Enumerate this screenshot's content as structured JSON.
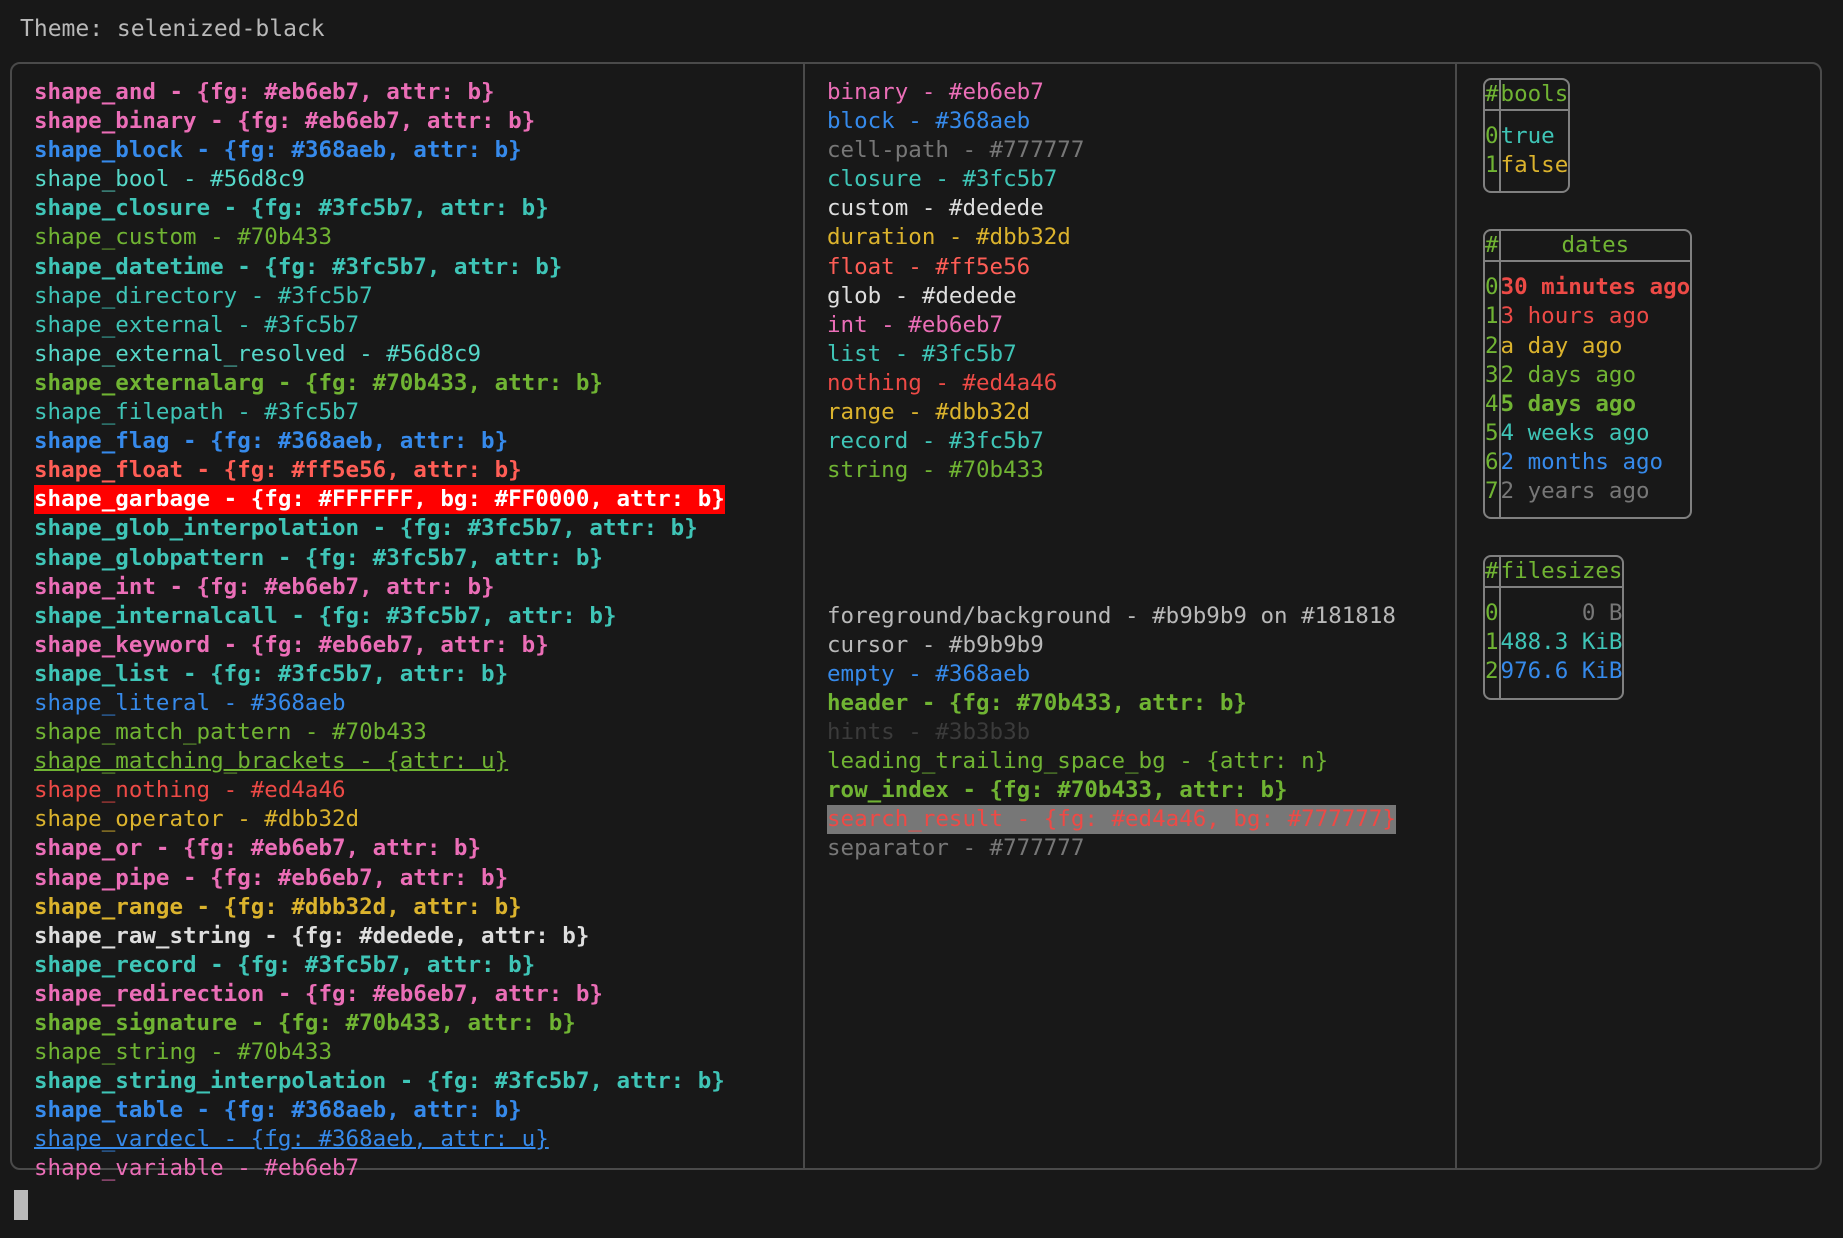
{
  "terminal": {
    "theme_label": "Theme: selenized-black",
    "background": "#181818",
    "foreground": "#b9b9b9",
    "cursor_color": "#b9b9b9"
  },
  "shapes": [
    {
      "name": "shape_and",
      "value": " - {fg: #eb6eb7, attr: b}",
      "color": "#eb6eb7",
      "bold": true
    },
    {
      "name": "shape_binary",
      "value": " - {fg: #eb6eb7, attr: b}",
      "color": "#eb6eb7",
      "bold": true
    },
    {
      "name": "shape_block",
      "value": " - {fg: #368aeb, attr: b}",
      "color": "#368aeb",
      "bold": true
    },
    {
      "name": "shape_bool",
      "value": " - #56d8c9",
      "color": "#56d8c9",
      "bold": false
    },
    {
      "name": "shape_closure",
      "value": " - {fg: #3fc5b7, attr: b}",
      "color": "#3fc5b7",
      "bold": true
    },
    {
      "name": "shape_custom",
      "value": " - #70b433",
      "color": "#70b433",
      "bold": false
    },
    {
      "name": "shape_datetime",
      "value": " - {fg: #3fc5b7, attr: b}",
      "color": "#3fc5b7",
      "bold": true
    },
    {
      "name": "shape_directory",
      "value": " - #3fc5b7",
      "color": "#3fc5b7",
      "bold": false
    },
    {
      "name": "shape_external",
      "value": " - #3fc5b7",
      "color": "#3fc5b7",
      "bold": false
    },
    {
      "name": "shape_external_resolved",
      "value": " - #56d8c9",
      "color": "#56d8c9",
      "bold": false
    },
    {
      "name": "shape_externalarg",
      "value": " - {fg: #70b433, attr: b}",
      "color": "#70b433",
      "bold": true
    },
    {
      "name": "shape_filepath",
      "value": " - #3fc5b7",
      "color": "#3fc5b7",
      "bold": false
    },
    {
      "name": "shape_flag",
      "value": " - {fg: #368aeb, attr: b}",
      "color": "#368aeb",
      "bold": true
    },
    {
      "name": "shape_float",
      "value": " - {fg: #ff5e56, attr: b}",
      "color": "#ff5e56",
      "bold": true
    },
    {
      "name": "shape_garbage",
      "value": " - {fg: #FFFFFF, bg: #FF0000, attr: b}",
      "color": "#FFFFFF",
      "bg": "#FF0000",
      "bold": true
    },
    {
      "name": "shape_glob_interpolation",
      "value": " - {fg: #3fc5b7, attr: b}",
      "color": "#3fc5b7",
      "bold": true
    },
    {
      "name": "shape_globpattern",
      "value": " - {fg: #3fc5b7, attr: b}",
      "color": "#3fc5b7",
      "bold": true
    },
    {
      "name": "shape_int",
      "value": " - {fg: #eb6eb7, attr: b}",
      "color": "#eb6eb7",
      "bold": true
    },
    {
      "name": "shape_internalcall",
      "value": " - {fg: #3fc5b7, attr: b}",
      "color": "#3fc5b7",
      "bold": true
    },
    {
      "name": "shape_keyword",
      "value": " - {fg: #eb6eb7, attr: b}",
      "color": "#eb6eb7",
      "bold": true
    },
    {
      "name": "shape_list",
      "value": " - {fg: #3fc5b7, attr: b}",
      "color": "#3fc5b7",
      "bold": true
    },
    {
      "name": "shape_literal",
      "value": " - #368aeb",
      "color": "#368aeb",
      "bold": false
    },
    {
      "name": "shape_match_pattern",
      "value": " - #70b433",
      "color": "#70b433",
      "bold": false
    },
    {
      "name": "shape_matching_brackets",
      "value": " - {attr: u}",
      "color": "#70b433",
      "bold": false,
      "underline": true
    },
    {
      "name": "shape_nothing",
      "value": " - #ed4a46",
      "color": "#ed4a46",
      "bold": false
    },
    {
      "name": "shape_operator",
      "value": " - #dbb32d",
      "color": "#dbb32d",
      "bold": false
    },
    {
      "name": "shape_or",
      "value": " - {fg: #eb6eb7, attr: b}",
      "color": "#eb6eb7",
      "bold": true
    },
    {
      "name": "shape_pipe",
      "value": " - {fg: #eb6eb7, attr: b}",
      "color": "#eb6eb7",
      "bold": true
    },
    {
      "name": "shape_range",
      "value": " - {fg: #dbb32d, attr: b}",
      "color": "#dbb32d",
      "bold": true
    },
    {
      "name": "shape_raw_string",
      "value": " - {fg: #dedede, attr: b}",
      "color": "#dedede",
      "bold": true
    },
    {
      "name": "shape_record",
      "value": " - {fg: #3fc5b7, attr: b}",
      "color": "#3fc5b7",
      "bold": true
    },
    {
      "name": "shape_redirection",
      "value": " - {fg: #eb6eb7, attr: b}",
      "color": "#eb6eb7",
      "bold": true
    },
    {
      "name": "shape_signature",
      "value": " - {fg: #70b433, attr: b}",
      "color": "#70b433",
      "bold": true
    },
    {
      "name": "shape_string",
      "value": " - #70b433",
      "color": "#70b433",
      "bold": false
    },
    {
      "name": "shape_string_interpolation",
      "value": " - {fg: #3fc5b7, attr: b}",
      "color": "#3fc5b7",
      "bold": true
    },
    {
      "name": "shape_table",
      "value": " - {fg: #368aeb, attr: b}",
      "color": "#368aeb",
      "bold": true
    },
    {
      "name": "shape_vardecl",
      "value": " - {fg: #368aeb, attr: u}",
      "color": "#368aeb",
      "bold": false,
      "underline": true
    },
    {
      "name": "shape_variable",
      "value": " - #eb6eb7",
      "color": "#eb6eb7",
      "bold": false
    }
  ],
  "types": [
    {
      "name": "binary",
      "value": " - #eb6eb7",
      "color": "#eb6eb7"
    },
    {
      "name": "block",
      "value": " - #368aeb",
      "color": "#368aeb"
    },
    {
      "name": "cell-path",
      "value": " - #777777",
      "color": "#777777"
    },
    {
      "name": "closure",
      "value": " - #3fc5b7",
      "color": "#3fc5b7"
    },
    {
      "name": "custom",
      "value": " - #dedede",
      "color": "#dedede"
    },
    {
      "name": "duration",
      "value": " - #dbb32d",
      "color": "#dbb32d"
    },
    {
      "name": "float",
      "value": " - #ff5e56",
      "color": "#ff5e56"
    },
    {
      "name": "glob",
      "value": " - #dedede",
      "color": "#dedede"
    },
    {
      "name": "int",
      "value": " - #eb6eb7",
      "color": "#eb6eb7"
    },
    {
      "name": "list",
      "value": " - #3fc5b7",
      "color": "#3fc5b7"
    },
    {
      "name": "nothing",
      "value": " - #ed4a46",
      "color": "#ed4a46"
    },
    {
      "name": "range",
      "value": " - #dbb32d",
      "color": "#dbb32d"
    },
    {
      "name": "record",
      "value": " - #3fc5b7",
      "color": "#3fc5b7"
    },
    {
      "name": "string",
      "value": " - #70b433",
      "color": "#70b433"
    }
  ],
  "ui_elements": [
    {
      "name": "foreground/background",
      "value": " - #b9b9b9 on #181818",
      "color": "#b9b9b9",
      "bold": false
    },
    {
      "name": "cursor",
      "value": " - #b9b9b9",
      "color": "#b9b9b9",
      "bold": false
    },
    {
      "name": "empty",
      "value": " - #368aeb",
      "color": "#368aeb",
      "bold": false
    },
    {
      "name": "header",
      "value": " - {fg: #70b433, attr: b}",
      "color": "#70b433",
      "bold": true
    },
    {
      "name": "hints",
      "value": " - #3b3b3b",
      "color": "#3b3b3b",
      "bold": false
    },
    {
      "name": "leading_trailing_space_bg",
      "value": " - {attr: n}",
      "color": "#70b433",
      "bold": false
    },
    {
      "name": "row_index",
      "value": " - {fg: #70b433, attr: b}",
      "color": "#70b433",
      "bold": true
    },
    {
      "name": "search_result",
      "value": " - {fg: #ed4a46, bg: #777777}",
      "color": "#ed4a46",
      "bg": "#777777",
      "bold": false
    },
    {
      "name": "separator",
      "value": " - #777777",
      "color": "#777777",
      "bold": false
    }
  ],
  "tables": [
    {
      "id": "bools",
      "index_header": "#",
      "value_header": "bools",
      "align": "left",
      "rows": [
        {
          "index": "0",
          "value": "true",
          "color": "#3fc5b7",
          "bold": false
        },
        {
          "index": "1",
          "value": "false",
          "color": "#dbb32d",
          "bold": false
        }
      ]
    },
    {
      "id": "dates",
      "index_header": "#",
      "value_header": "dates",
      "align": "left",
      "rows": [
        {
          "index": "0",
          "value": "30 minutes ago",
          "color": "#ed4a46",
          "bold": true
        },
        {
          "index": "1",
          "value": "3 hours ago",
          "color": "#ed4a46",
          "bold": false
        },
        {
          "index": "2",
          "value": "a day ago",
          "color": "#dbb32d",
          "bold": false
        },
        {
          "index": "3",
          "value": "2 days ago",
          "color": "#70b433",
          "bold": false
        },
        {
          "index": "4",
          "value": "5 days ago",
          "color": "#70b433",
          "bold": true
        },
        {
          "index": "5",
          "value": "4 weeks ago",
          "color": "#3fc5b7",
          "bold": false
        },
        {
          "index": "6",
          "value": "2 months ago",
          "color": "#368aeb",
          "bold": false
        },
        {
          "index": "7",
          "value": "2 years ago",
          "color": "#777777",
          "bold": false
        }
      ]
    },
    {
      "id": "filesizes",
      "index_header": "#",
      "value_header": "filesizes",
      "align": "right",
      "rows": [
        {
          "index": "0",
          "value": "0 B",
          "color": "#777777",
          "bold": false
        },
        {
          "index": "1",
          "value": "488.3 KiB",
          "color": "#3fc5b7",
          "bold": false
        },
        {
          "index": "2",
          "value": "976.6 KiB",
          "color": "#368aeb",
          "bold": false
        }
      ]
    }
  ]
}
